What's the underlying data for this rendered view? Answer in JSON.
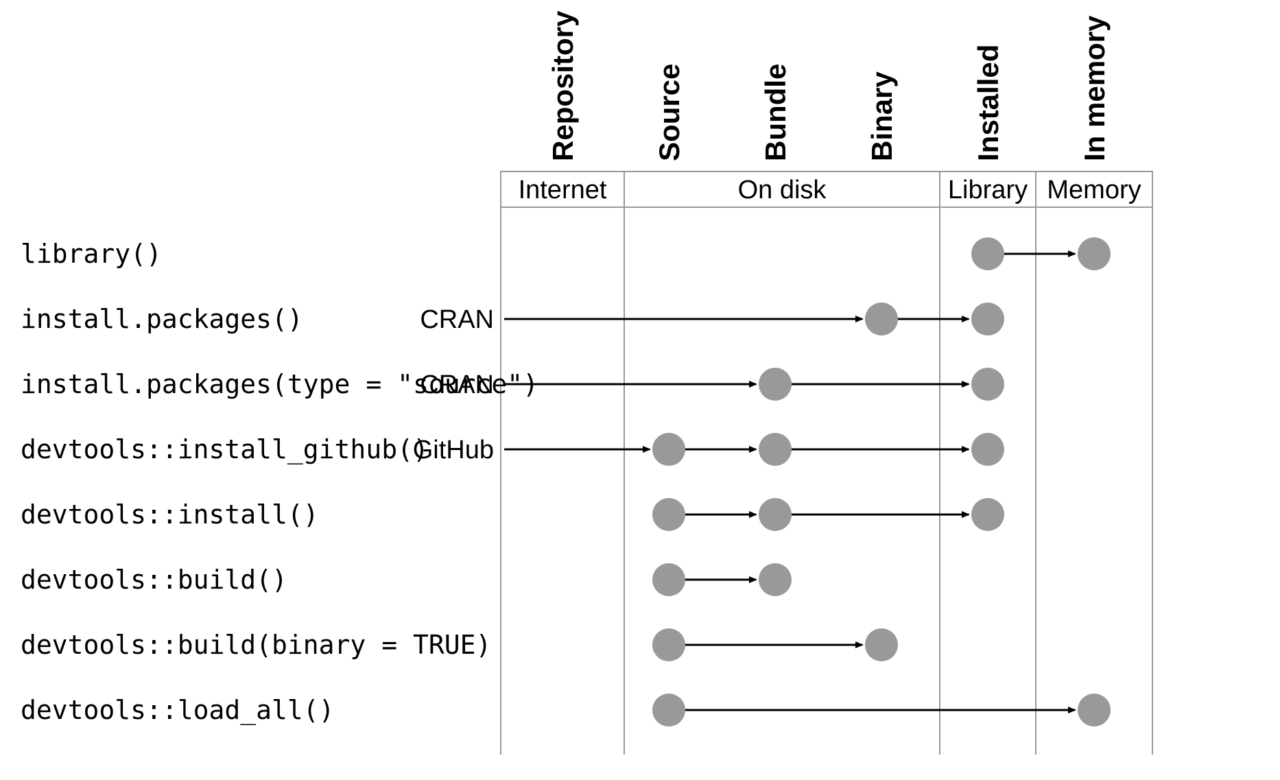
{
  "columns": {
    "repository": "Repository",
    "source": "Source",
    "bundle": "Bundle",
    "binary": "Binary",
    "installed": "Installed",
    "inmemory": "In memory"
  },
  "locations": {
    "internet": "Internet",
    "ondisk": "On disk",
    "library": "Library",
    "memory": "Memory"
  },
  "rows": {
    "library": {
      "label": "library()",
      "repo": ""
    },
    "install_packages": {
      "label": "install.packages()",
      "repo": "CRAN"
    },
    "install_source": {
      "label": "install.packages(type = \"source\")",
      "repo": "CRAN"
    },
    "install_github": {
      "label": "devtools::install_github()",
      "repo": "GitHub"
    },
    "install": {
      "label": "devtools::install()",
      "repo": ""
    },
    "build": {
      "label": "devtools::build()",
      "repo": ""
    },
    "build_binary": {
      "label": "devtools::build(binary = TRUE)",
      "repo": ""
    },
    "load_all": {
      "label": "devtools::load_all()",
      "repo": ""
    }
  }
}
